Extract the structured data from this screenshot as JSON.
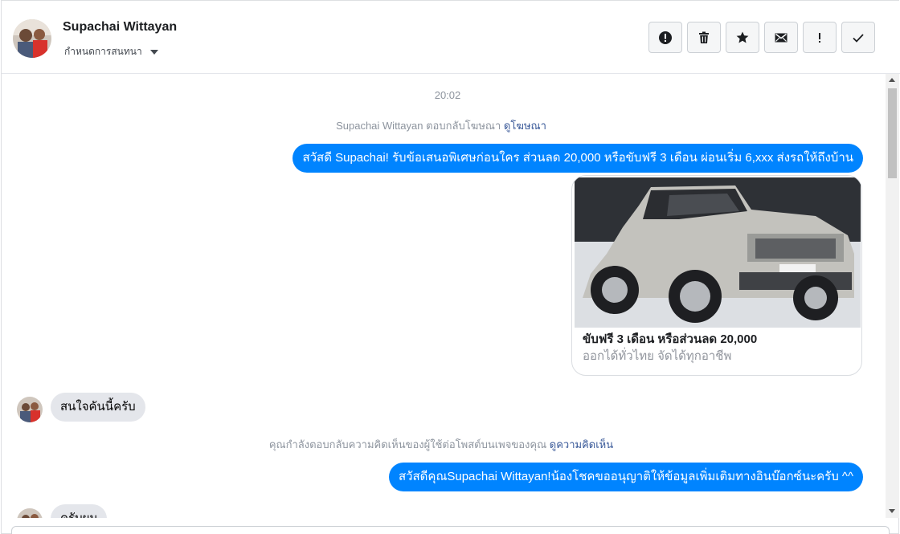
{
  "header": {
    "contact_name": "Supachai Wittayan",
    "assign_label": "กำหนดการสนทนา"
  },
  "actions": [
    {
      "icon": "alert-circle-icon",
      "name": "report-button"
    },
    {
      "icon": "trash-icon",
      "name": "delete-button"
    },
    {
      "icon": "star-icon",
      "name": "star-button"
    },
    {
      "icon": "envelope-icon",
      "name": "mark-unread-button"
    },
    {
      "icon": "exclamation-icon",
      "name": "follow-up-button"
    },
    {
      "icon": "check-icon",
      "name": "mark-done-button"
    }
  ],
  "chat": {
    "timestamp": "20:02",
    "ad_reply_notice": "Supachai Wittayan ตอบกลับโฆษณา",
    "ad_reply_link": "ดูโฆษณา",
    "outgoing_1": "สวัสดี Supachai! รับข้อเสนอพิเศษก่อนใคร ส่วนลด 20,000 หรือขับฟรี 3 เดือน ผ่อนเริ่ม 6,xxx ส่งรถให้ถึงบ้าน",
    "card": {
      "title": "ขับฟรี 3 เดือน หรือส่วนลด 20,000",
      "subtitle": "ออกได้ทั่วไทย จัดได้ทุกอาชีพ"
    },
    "incoming_1": "สนใจคันนี้ครับ",
    "comment_notice": "คุณกำลังตอบกลับความคิดเห็นของผู้ใช้ต่อโพสต์บนเพจของคุณ",
    "comment_link": "ดูความคิดเห็น",
    "outgoing_2": "สวัสดีคุณSupachai Wittayan!น้องโชคขออนุญาติให้ข้อมูลเพิ่มเติมทางอินบ๊อกซ์นะครับ ^^",
    "incoming_2": "ครับผม"
  },
  "colors": {
    "outgoing_bubble": "#0084ff",
    "incoming_bubble": "#e4e6eb",
    "link": "#385898",
    "muted_text": "#8d949e"
  }
}
